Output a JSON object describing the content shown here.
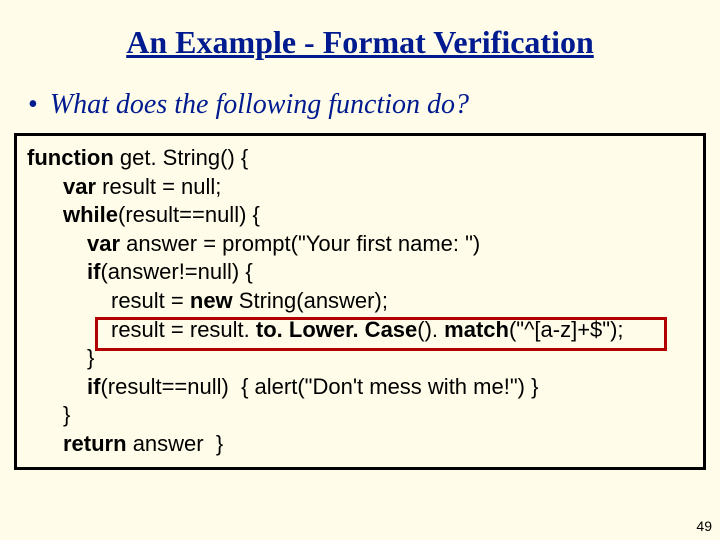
{
  "title": "An Example - Format Verification",
  "bullet": "What does the following function do?",
  "code": {
    "l1a": "function ",
    "l1b": "get. String() {",
    "l2a": "var ",
    "l2b": "result = null;",
    "l3a": "while",
    "l3b": "(result==null) {",
    "l4a": "var ",
    "l4b": "answer = prompt(\"Your first name: \")",
    "l5a": "if",
    "l5b": "(answer!=null) {",
    "l6a": "result = ",
    "l6b": "new ",
    "l6c": "String(answer);",
    "l7a": "result = result. ",
    "l7b": "to. Lower. Case",
    "l7c": "(). ",
    "l7d": "match",
    "l7e": "(\"^[a-z]+$\");",
    "l8": "}",
    "l9a": "if",
    "l9b": "(result==null)  { alert(\"Don't mess with me!\") }",
    "l10": "}",
    "l11a": "return ",
    "l11b": "answer  }"
  },
  "page_number": "49"
}
